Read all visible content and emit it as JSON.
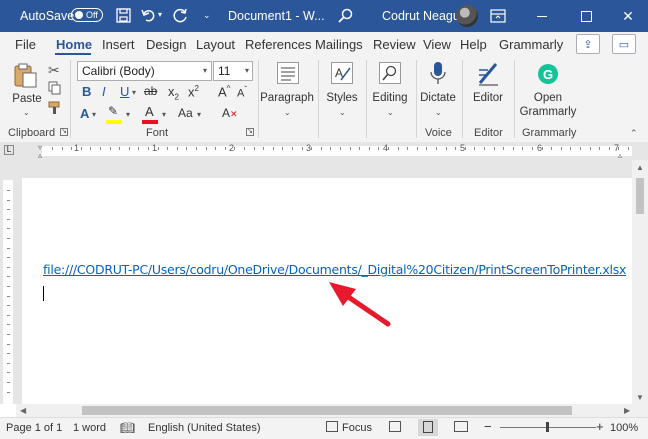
{
  "titlebar": {
    "autosave_label": "AutoSave",
    "autosave_state": "Off",
    "doc_title": "Document1 - W...",
    "user_name": "Codrut Neagu"
  },
  "tabs": [
    "File",
    "Home",
    "Insert",
    "Design",
    "Layout",
    "References",
    "Mailings",
    "Review",
    "View",
    "Help",
    "Grammarly"
  ],
  "active_tab": "Home",
  "ribbon": {
    "paste_label": "Paste",
    "clipboard_group": "Clipboard",
    "font_name": "Calibri (Body)",
    "font_size": "11",
    "font_group": "Font",
    "paragraph_label": "Paragraph",
    "styles_label": "Styles",
    "editing_label": "Editing",
    "dictate_label": "Dictate",
    "voice_group": "Voice",
    "editor_label": "Editor",
    "editor_group": "Editor",
    "grammarly_btn_line1": "Open",
    "grammarly_btn_line2": "Grammarly",
    "grammarly_group": "Grammarly",
    "bold": "B",
    "italic": "I",
    "underline": "U",
    "strike": "ab",
    "subscript": "x",
    "superscript": "x",
    "grow": "A",
    "shrink": "A",
    "case": "Aa",
    "clear": "A",
    "text_effects": "A",
    "highlight": "ab",
    "font_color": "A"
  },
  "ruler": {
    "numbers": [
      "1",
      "1",
      "2",
      "3",
      "4",
      "5",
      "6",
      "7"
    ]
  },
  "document": {
    "link_text": "file:///CODRUT-PC/Users/codru/OneDrive/Documents/_Digital%20Citizen/PrintScreenToPrinter.xlsx"
  },
  "status": {
    "page": "Page 1 of 1",
    "words": "1 word",
    "language": "English (United States)",
    "focus": "Focus",
    "zoom": "100%"
  },
  "colors": {
    "title_bar": "#2b579a",
    "link": "#0563c1",
    "arrow": "#e8192c",
    "highlight_yellow": "#ffff00",
    "font_red": "#e81123",
    "grammarly_green": "#15c39a"
  }
}
